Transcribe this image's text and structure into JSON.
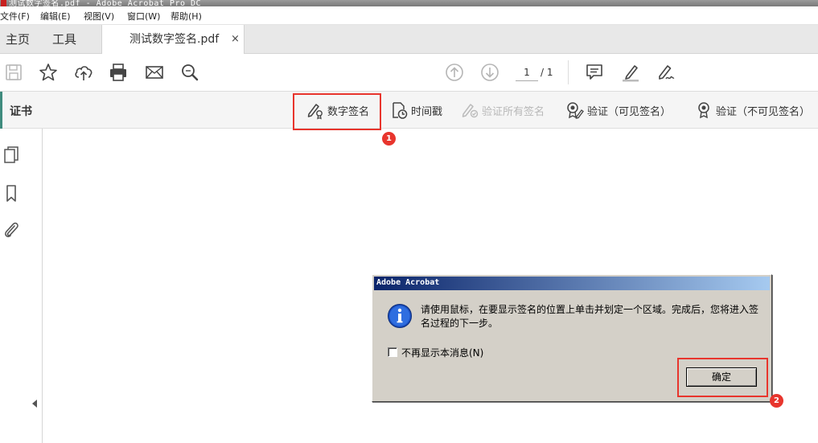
{
  "window": {
    "title": "测试数字签名.pdf - Adobe Acrobat Pro DC"
  },
  "menu": {
    "items": [
      "文件(F)",
      "编辑(E)",
      "视图(V)",
      "窗口(W)",
      "帮助(H)"
    ]
  },
  "tabs": {
    "home": "主页",
    "tools": "工具",
    "document": "测试数字签名.pdf",
    "close_glyph": "×"
  },
  "toolbar": {
    "icons": [
      "save-icon",
      "star-icon",
      "upload-icon",
      "print-icon",
      "email-icon",
      "zoom-search-icon",
      "page-up-icon",
      "page-down-icon",
      "comment-icon",
      "highlight-pen-icon",
      "sign-icon"
    ],
    "page_current": "1",
    "page_total": "/ 1"
  },
  "cert_bar": {
    "title": "证书",
    "tools": {
      "digital_signature": "数字签名",
      "timestamp": "时间戳",
      "validate_all": "验证所有签名",
      "validate_visible": "验证（可见签名）",
      "validate_invisible": "验证（不可见签名）"
    },
    "accent_color": "#3f8b7e"
  },
  "annotations": {
    "marker_1": "1",
    "marker_2": "2",
    "highlight_color": "#e8352d"
  },
  "dialog": {
    "title": "Adobe Acrobat",
    "message": "请使用鼠标，在要显示签名的位置上单击并划定一个区域。完成后，您将进入签名过程的下一步。",
    "checkbox_label": "不再显示本消息(N)",
    "checkbox_checked": false,
    "ok_button": "确定"
  }
}
